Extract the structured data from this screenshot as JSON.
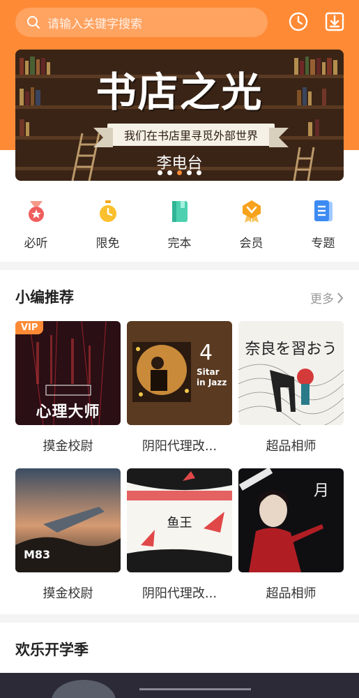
{
  "search": {
    "placeholder": "请输入关键字搜索"
  },
  "banner": {
    "title": "书店之光",
    "ribbon": "我们在书店里寻觅外部世界",
    "subtitle": "李电台",
    "dots": 5,
    "active_dot": 3
  },
  "quick_nav": [
    {
      "label": "必听",
      "icon": "medal-icon"
    },
    {
      "label": "限免",
      "icon": "stopwatch-icon"
    },
    {
      "label": "完本",
      "icon": "book-icon"
    },
    {
      "label": "会员",
      "icon": "vip-badge-icon"
    },
    {
      "label": "专题",
      "icon": "document-list-icon"
    }
  ],
  "editor_picks": {
    "title": "小编推荐",
    "more": "更多",
    "items": [
      {
        "title": "摸金校尉",
        "badge": "VIP",
        "cover_text": "心理大师"
      },
      {
        "title": "阴阳代理改...",
        "cover_text": "Sitar in Jazz"
      },
      {
        "title": "超品相师",
        "cover_text": "奈良を習おう"
      },
      {
        "title": "摸金校尉",
        "cover_text": "M83"
      },
      {
        "title": "阴阳代理改...",
        "cover_text": "鱼王"
      },
      {
        "title": "超品相师",
        "cover_text": "月"
      }
    ]
  },
  "season": {
    "title": "欢乐开学季"
  },
  "colors": {
    "accent": "#ff8a35"
  }
}
